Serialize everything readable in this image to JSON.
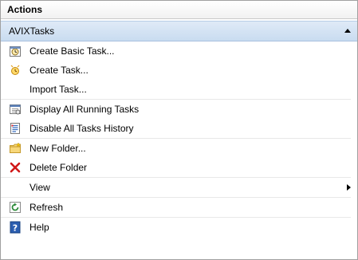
{
  "pane": {
    "title": "Actions"
  },
  "section": {
    "title": "AVIXTasks"
  },
  "items": [
    {
      "label": "Create Basic Task...",
      "icon": "wizard-icon"
    },
    {
      "label": "Create Task...",
      "icon": "new-task-icon"
    },
    {
      "label": "Import Task...",
      "icon": ""
    },
    {
      "label": "Display All Running Tasks",
      "icon": "running-tasks-icon"
    },
    {
      "label": "Disable All Tasks History",
      "icon": "history-icon"
    },
    {
      "label": "New Folder...",
      "icon": "new-folder-icon"
    },
    {
      "label": "Delete Folder",
      "icon": "delete-icon"
    },
    {
      "label": "View",
      "icon": ""
    },
    {
      "label": "Refresh",
      "icon": "refresh-icon"
    },
    {
      "label": "Help",
      "icon": "help-icon"
    }
  ],
  "colors": {
    "section_bg": "#c9dcf0",
    "delete_red": "#d01818",
    "help_blue": "#2a5db0",
    "refresh_green": "#2e8b3a"
  }
}
